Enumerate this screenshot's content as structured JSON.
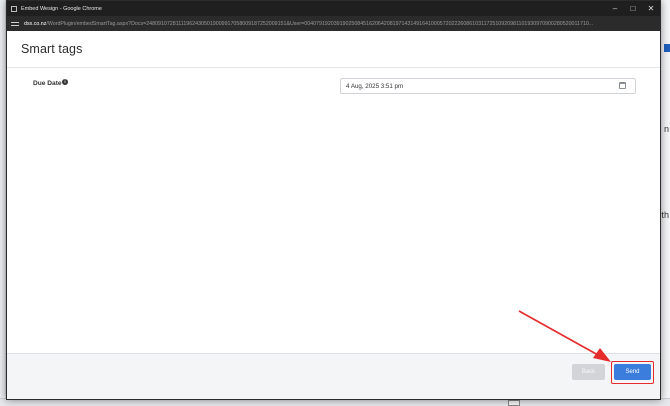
{
  "window": {
    "title": "Embed Wesign - Google Chrome",
    "controls": {
      "minimize": "–",
      "maximize": "□",
      "close": "✕"
    }
  },
  "address_bar": {
    "host": "dsx.co.nz",
    "path": "/WordPlugin/embedSmartTag.aspx?Docs=248091072811119624305019009917058009187252009151&User=0040791920391902508451620642081971431491641000572022260861031172510920981101930970900280520011710..."
  },
  "page": {
    "title": "Smart tags",
    "form": {
      "due_date": {
        "label": "Due Date",
        "info_icon": "info-icon",
        "value": "4 Aug, 2025 3:51 pm",
        "calendar_icon": "calendar-icon"
      }
    },
    "footer": {
      "back_label": "Back",
      "send_label": "Send"
    }
  },
  "annotation": {
    "color": "#e52b2b",
    "arrow_target": "send-button"
  },
  "colors": {
    "primary_button": "#3b7ddd",
    "disabled_button": "#d2d4d7",
    "titlebar": "#1f1f1f"
  },
  "background_app": {
    "right_edge_chars": [
      "n",
      "th"
    ]
  }
}
